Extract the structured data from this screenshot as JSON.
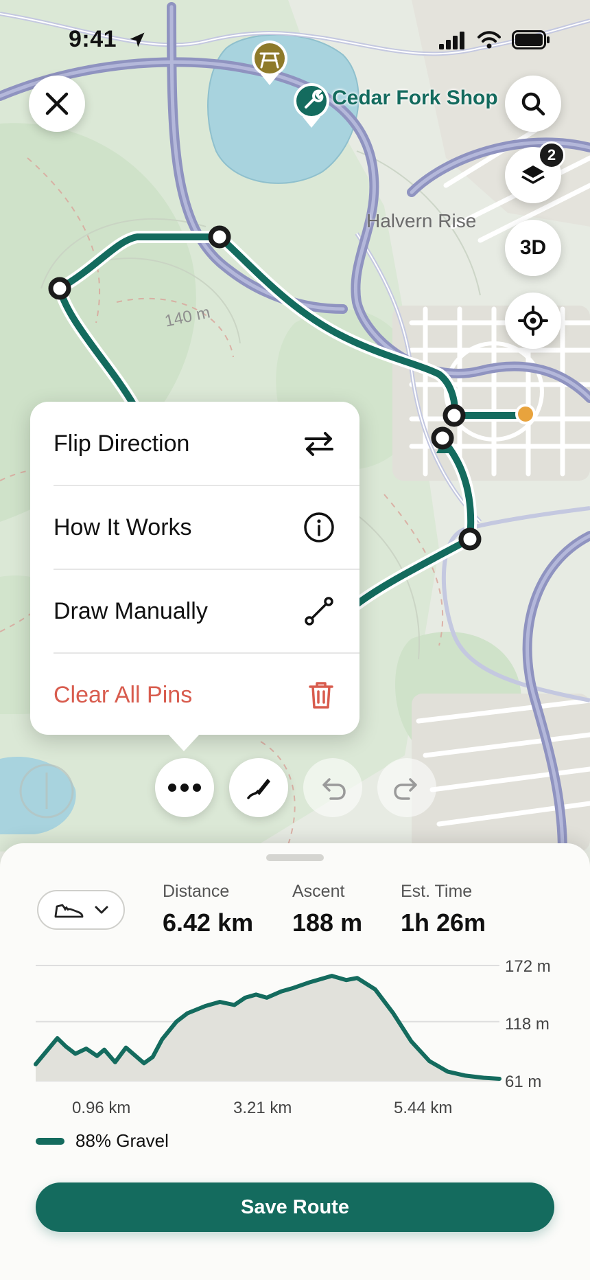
{
  "status_bar": {
    "time": "9:41"
  },
  "map": {
    "places": [
      {
        "name": "Cedar Fork Shop",
        "icon": "wrench-icon"
      },
      {
        "name": "Halvern Rise"
      }
    ],
    "contour_label": "140 m",
    "layers_badge": "2",
    "view_3d_label": "3D"
  },
  "menu": {
    "items": [
      {
        "label": "Flip Direction",
        "icon": "swap-arrows-icon"
      },
      {
        "label": "How It Works",
        "icon": "info-icon"
      },
      {
        "label": "Draw Manually",
        "icon": "line-segment-icon"
      },
      {
        "label": "Clear All Pins",
        "icon": "trash-icon",
        "destructive": true
      }
    ]
  },
  "route_summary": {
    "mode_icon": "shoe-icon",
    "stats": [
      {
        "label": "Distance",
        "value": "6.42 km"
      },
      {
        "label": "Ascent",
        "value": "188 m"
      },
      {
        "label": "Est. Time",
        "value": "1h 26m"
      }
    ],
    "surface_legend": "88% Gravel",
    "save_label": "Save Route"
  },
  "chart_data": {
    "type": "area",
    "x_unit": "km",
    "y_unit": "m",
    "xlim": [
      0,
      6.42
    ],
    "ylim": [
      61,
      172
    ],
    "y_ticks": [
      "172 m",
      "118 m",
      "61 m"
    ],
    "y_tick_values": [
      172,
      118,
      61
    ],
    "x_ticks": [
      "0.96 km",
      "3.21 km",
      "5.44 km"
    ],
    "x_tick_values": [
      0.96,
      3.21,
      5.44
    ],
    "series": [
      {
        "x": [
          0,
          0.3,
          0.42,
          0.55,
          0.7,
          0.85,
          0.95,
          1.1,
          1.25,
          1.5,
          1.62,
          1.75,
          1.95,
          2.1,
          2.35,
          2.55,
          2.75,
          2.9,
          3.05,
          3.2,
          3.4,
          3.55,
          3.8,
          4.1,
          4.3,
          4.45,
          4.7,
          4.95,
          5.2,
          5.45,
          5.7,
          5.95,
          6.2,
          6.42
        ],
        "y": [
          77,
          102,
          94,
          87,
          92,
          85,
          91,
          79,
          93,
          78,
          84,
          101,
          118,
          126,
          133,
          137,
          134,
          141,
          144,
          141,
          147,
          150,
          156,
          162,
          158,
          160,
          149,
          126,
          99,
          80,
          70,
          66,
          64,
          63
        ]
      }
    ],
    "grid": true,
    "legend": "bottom-left"
  }
}
